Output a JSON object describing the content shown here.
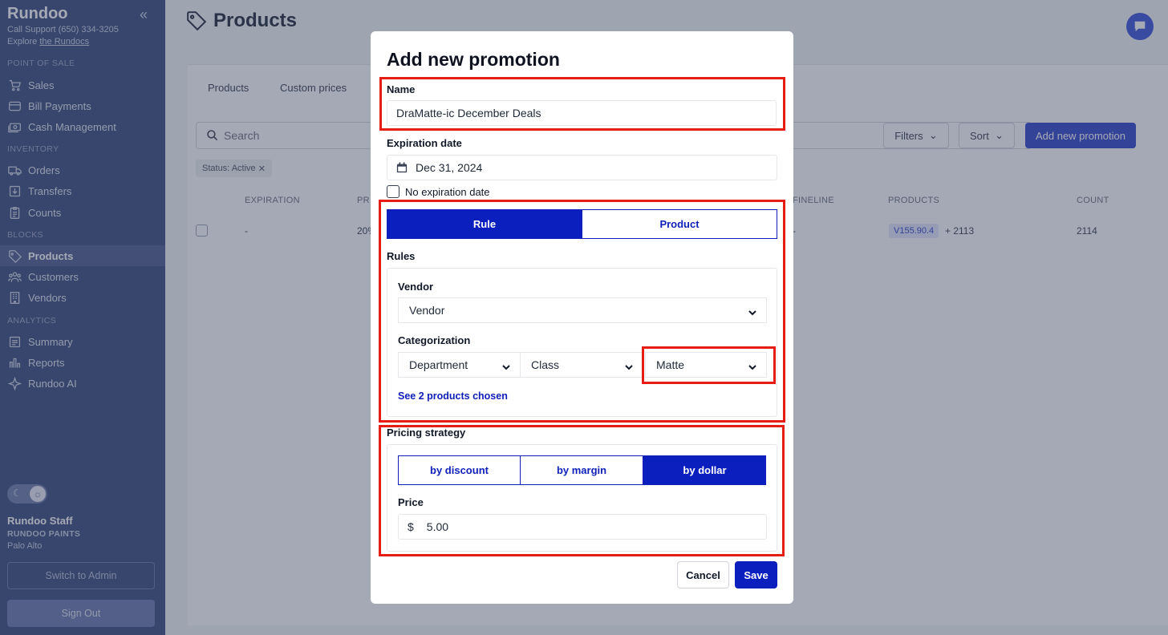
{
  "sidebar": {
    "brand": "Rundoo",
    "support_line": "Call Support (650) 334-3205",
    "explore_prefix": "Explore ",
    "explore_link": "the Rundocs",
    "sections": {
      "pos": "POINT OF SALE",
      "inventory": "INVENTORY",
      "blocks": "BLOCKS",
      "analytics": "ANALYTICS"
    },
    "items": {
      "sales": "Sales",
      "bill_payments": "Bill Payments",
      "cash_management": "Cash Management",
      "orders": "Orders",
      "transfers": "Transfers",
      "counts": "Counts",
      "products": "Products",
      "customers": "Customers",
      "vendors": "Vendors",
      "summary": "Summary",
      "reports": "Reports",
      "rundoo_ai": "Rundoo AI"
    },
    "user": {
      "name": "Rundoo Staff",
      "org": "RUNDOO PAINTS",
      "location": "Palo Alto"
    },
    "switch_admin": "Switch to Admin",
    "sign_out": "Sign Out"
  },
  "main": {
    "title": "Products",
    "tabs": {
      "products": "Products",
      "custom_prices": "Custom prices"
    },
    "search_placeholder": "Search",
    "filters_label": "Filters",
    "sort_label": "Sort",
    "add_promotion_label": "Add new promotion",
    "status_chip": "Status: Active",
    "table": {
      "headers": {
        "expiration": "EXPIRATION",
        "pr": "PR",
        "fineline": "FINELINE",
        "products": "PRODUCTS",
        "count": "COUNT"
      },
      "row": {
        "expiration": "-",
        "pr": "20%",
        "fineline": "-",
        "sku": "V155.90.4",
        "more": "+ 2113",
        "count": "2114"
      }
    }
  },
  "modal": {
    "title": "Add new promotion",
    "name_label": "Name",
    "name_value": "DraMatte-ic December Deals",
    "expiration_label": "Expiration date",
    "expiration_value": "Dec 31, 2024",
    "no_expiration_label": "No expiration date",
    "mode_options": {
      "rule": "Rule",
      "product": "Product"
    },
    "rules_label": "Rules",
    "vendor_label": "Vendor",
    "vendor_value": "Vendor",
    "categorization_label": "Categorization",
    "department_value": "Department",
    "class_value": "Class",
    "fineline_value": "Matte",
    "products_chosen_link": "See 2 products chosen",
    "pricing_label": "Pricing strategy",
    "pricing_options": {
      "discount": "by discount",
      "margin": "by margin",
      "dollar": "by dollar"
    },
    "price_label": "Price",
    "price_currency": "$",
    "price_value": "5.00",
    "cancel_label": "Cancel",
    "save_label": "Save"
  },
  "colors": {
    "accent": "#0b1fbf",
    "sidebar": "#3a4a7d",
    "annotation": "#e51d12"
  }
}
